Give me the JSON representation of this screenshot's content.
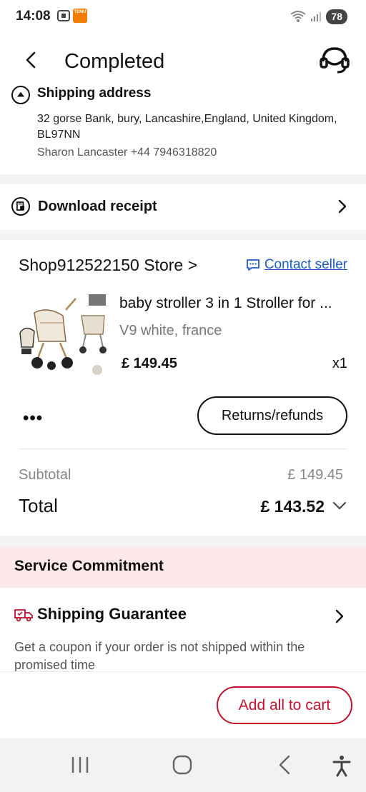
{
  "status_bar": {
    "time": "14:08",
    "app_badge": "TEMU",
    "battery": "78"
  },
  "header": {
    "title": "Completed"
  },
  "shipping": {
    "heading": "Shipping address",
    "address": "32 gorse Bank, bury, Lancashire,England, United Kingdom, BL97NN",
    "contact": "Sharon Lancaster +44 7946318820"
  },
  "receipt": {
    "label": "Download receipt"
  },
  "order": {
    "store_name": "Shop912522150 Store >",
    "contact_seller": "Contact seller",
    "product": {
      "title": "baby stroller 3 in 1 Stroller for ...",
      "variant": "V9 white, france",
      "price": "£ 149.45",
      "quantity": "x1"
    },
    "more": "•••",
    "returns_label": "Returns/refunds",
    "subtotal_label": "Subtotal",
    "subtotal_value": "£ 149.45",
    "total_label": "Total",
    "total_value": "£ 143.52"
  },
  "service": {
    "title": "Service Commitment",
    "guarantee_title": "Shipping Guarantee",
    "guarantee_desc": "Get a coupon if your order is not shipped within the promised time"
  },
  "bottom": {
    "add_all_label": "Add all to cart"
  },
  "colors": {
    "accent_red": "#c8102e",
    "link_blue": "#1a5dc8",
    "banner_pink": "#fde8ea"
  },
  "icons": {
    "back": "chevron-left-icon",
    "support": "headset-icon",
    "shipping": "location-icon",
    "receipt": "receipt-icon",
    "chat": "chat-icon",
    "truck": "truck-icon"
  }
}
